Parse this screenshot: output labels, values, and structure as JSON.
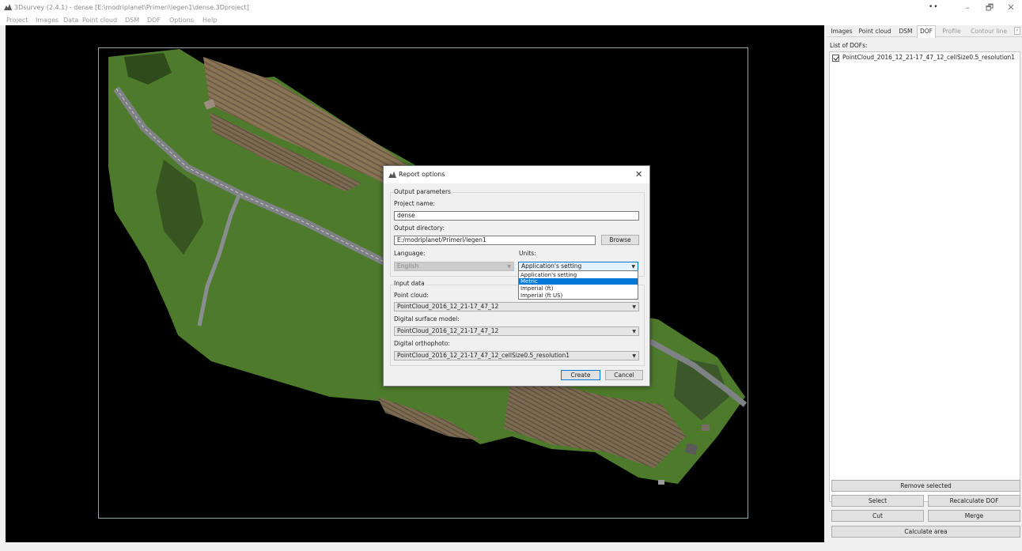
{
  "window": {
    "title": "3Dsurvey (2.4.1) - dense [E:\\modriplanet\\Primeri\\legen1\\dense.3Dproject]",
    "dots": "••",
    "minimize": "–",
    "maximize": "🗗",
    "close": "✕"
  },
  "menu": [
    "Project",
    "Images",
    "Data",
    "Point cloud",
    "DSM",
    "DOF",
    "Options",
    "Help"
  ],
  "panel": {
    "tabs": [
      "Images",
      "Point cloud",
      "DSM",
      "DOF",
      "Profile",
      "Contour line"
    ],
    "active_tab": "DOF",
    "tab_scroll": "›",
    "list_title": "List of DOFs:",
    "items": [
      {
        "label": "PointCloud_2016_12_21-17_47_12_cellSize0.5_resolution1",
        "checked": true
      }
    ],
    "buttons": {
      "remove_selected": "Remove selected",
      "select": "Select",
      "recalculate": "Recalculate DOF",
      "cut": "Cut",
      "merge": "Merge",
      "calculate_area": "Calculate area"
    }
  },
  "dialog": {
    "title": "Report options",
    "close": "✕",
    "output_group": "Output parameters",
    "project_name_label": "Project name:",
    "project_name_value": "dense",
    "output_dir_label": "Output directory:",
    "output_dir_value": "E:/modriplanet/Primeri/legen1",
    "browse": "Browse",
    "language_label": "Language:",
    "language_value": "English",
    "units_label": "Units:",
    "units_value": "Application's setting",
    "units_options": [
      "Application's setting",
      "Metric",
      "Imperial (ft)",
      "Imperial (ft US)"
    ],
    "units_highlighted": "Metric",
    "input_group": "Input data",
    "point_cloud_label": "Point cloud:",
    "point_cloud_value": "PointCloud_2016_12_21-17_47_12",
    "dsm_label": "Digital surface model:",
    "dsm_value": "PointCloud_2016_12_21-17_47_12",
    "dof_label": "Digital orthophoto:",
    "dof_value": "PointCloud_2016_12_21-17_47_12_cellSize0.5_resolution1",
    "create": "Create",
    "cancel": "Cancel",
    "arrow": "▼"
  },
  "colors": {
    "accent": "#0078d7",
    "viewport_bg": "#000000",
    "field_green": "#4a7a2a",
    "field_brown": "#8a7456",
    "road_gray": "#7e8285"
  }
}
